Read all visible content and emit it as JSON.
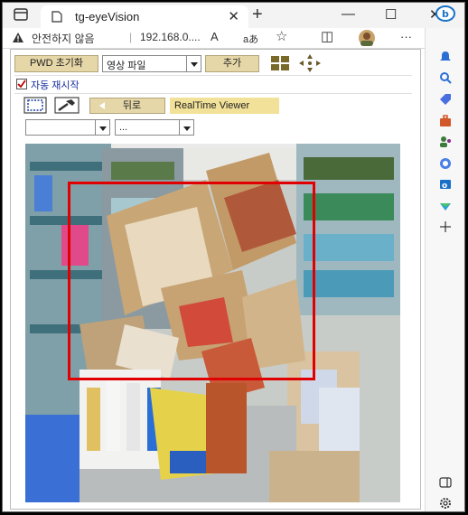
{
  "browser": {
    "tab_title": "tg-eyeVision",
    "tab_close_glyph": "✕",
    "new_tab_glyph": "+",
    "window_controls": {
      "minimize": "—",
      "maximize": "☐",
      "close": "✕"
    },
    "address": {
      "security_warning": "안전하지 않음",
      "separator": "|",
      "url": "192.168.0....",
      "read_aloud": "A",
      "translate": "aあ",
      "favorite": "☆",
      "split": "◫",
      "more": "···"
    }
  },
  "toolbar": {
    "pwd_reset_label": "PWD 초기화",
    "file_select_value": "영상 파일",
    "add_label": "추가",
    "auto_restart_label": "자동 재시작",
    "auto_restart_checked": true,
    "back_label": "뒤로",
    "realtime_label": "RealTime Viewer",
    "select_a_value": "",
    "select_b_value": "..."
  },
  "colors": {
    "button_tan": "#e6d7a8",
    "detection_box": "#e00000",
    "realtime_bg": "#f2e199"
  },
  "sidebar_icons": [
    "copilot-icon",
    "bell-icon",
    "search-icon",
    "tag-icon",
    "toolbox-icon",
    "people-icon",
    "office-icon",
    "outlook-icon",
    "send-icon",
    "add-icon",
    "sidebar-toggle-icon",
    "settings-icon"
  ]
}
